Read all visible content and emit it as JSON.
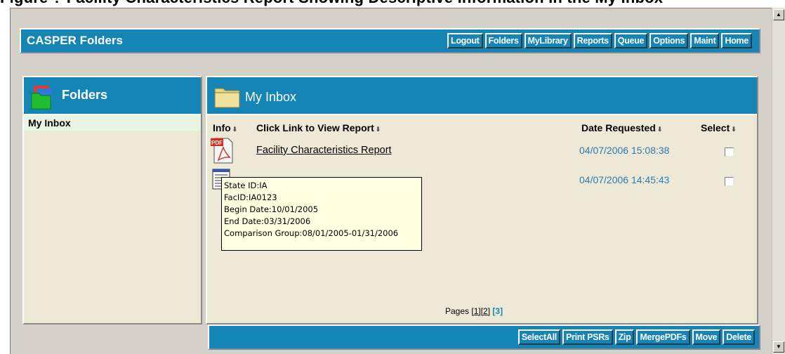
{
  "app": {
    "heading_strip": "Figure ? Facility Characteristics Report Showing Descriptive Information in the My Inbox",
    "title": "CASPER Folders"
  },
  "nav": {
    "items": [
      "Logout",
      "Folders",
      "MyLibrary",
      "Reports",
      "Queue",
      "Options",
      "Maint",
      "Home"
    ]
  },
  "folders_panel": {
    "title": "Folders",
    "items": [
      "My Inbox"
    ]
  },
  "inbox": {
    "title": "My Inbox",
    "columns": {
      "info": "Info",
      "report": "Click Link to View Report",
      "date": "Date Requested",
      "select": "Select"
    },
    "rows": [
      {
        "type": "pdf",
        "icon": "pdf-icon",
        "report": "Facility Characteristics Report",
        "date": "04/07/2006 15:08:38",
        "selected": false
      },
      {
        "type": "doc",
        "icon": "document-icon",
        "report": "",
        "date": "04/07/2006 14:45:43",
        "selected": false
      }
    ],
    "tooltip": {
      "lines": [
        "State ID:IA",
        "FacID:IA0123",
        "Begin Date:10/01/2005",
        "End Date:03/31/2006",
        "Comparison Group:08/01/2005-01/31/2006"
      ]
    },
    "pager": {
      "label": "Pages",
      "pages": [
        "[1]",
        "[2]"
      ],
      "current": "[3]"
    }
  },
  "actions": {
    "items": [
      "SelectAll",
      "Print PSRs",
      "Zip",
      "MergePDFs",
      "Move",
      "Delete"
    ]
  },
  "colors": {
    "accent": "#1585b5",
    "panel_bg": "#ede9d6",
    "date_text": "#2a7ab3",
    "tooltip_bg": "#ffffe1"
  }
}
